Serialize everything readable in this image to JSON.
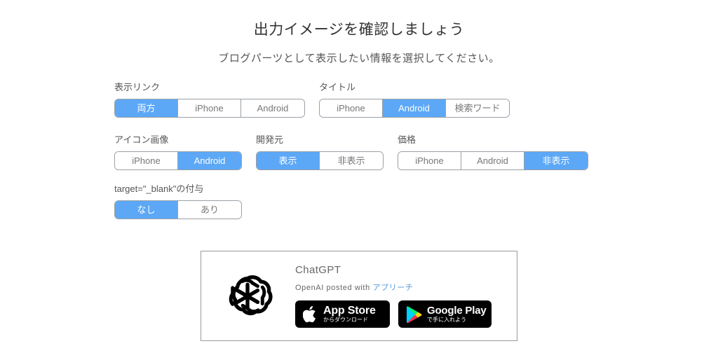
{
  "header": {
    "title": "出力イメージを確認しましょう",
    "subtitle": "ブログパーツとして表示したい情報を選択してください。"
  },
  "colors": {
    "selected_blue": "#5ca8f7",
    "border_gray": "#9aa0a6",
    "text_gray": "#555555",
    "link_blue": "#5b9bd5"
  },
  "option_groups": [
    {
      "key": "display_link",
      "label": "表示リンク",
      "options": [
        "両方",
        "iPhone",
        "Android"
      ],
      "selected_index": 0
    },
    {
      "key": "title",
      "label": "タイトル",
      "options": [
        "iPhone",
        "Android",
        "検索ワード"
      ],
      "selected_index": 1
    },
    {
      "key": "icon_image",
      "label": "アイコン画像",
      "options": [
        "iPhone",
        "Android"
      ],
      "selected_index": 1
    },
    {
      "key": "developer",
      "label": "開発元",
      "options": [
        "表示",
        "非表示"
      ],
      "selected_index": 0
    },
    {
      "key": "price",
      "label": "価格",
      "options": [
        "iPhone",
        "Android",
        "非表示"
      ],
      "selected_index": 2
    },
    {
      "key": "target_blank",
      "label": "target=\"_blank\"の付与",
      "options": [
        "なし",
        "あり"
      ],
      "selected_index": 0
    }
  ],
  "preview": {
    "icon_name": "openai-logo-icon",
    "app_name": "ChatGPT",
    "meta_prefix": "OpenAI posted with",
    "meta_link": "アプリーチ",
    "badges": [
      {
        "key": "appstore",
        "glyph": "apple-logo-icon",
        "main": "App Store",
        "sub": "からダウンロード"
      },
      {
        "key": "googleplay",
        "glyph": "google-play-triangle-icon",
        "main": "Google Play",
        "sub": "で手に入れよう"
      }
    ]
  }
}
